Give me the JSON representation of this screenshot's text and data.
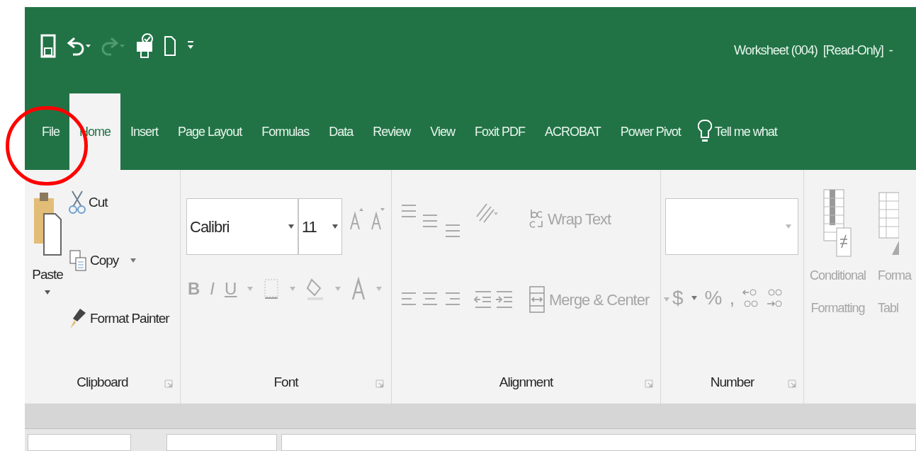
{
  "title": "Worksheet (004)  [Read-Only]  -",
  "tabs": [
    {
      "label": "File",
      "selected": false
    },
    {
      "label": "Home",
      "selected": true
    },
    {
      "label": "Insert",
      "selected": false
    },
    {
      "label": "Page Layout",
      "selected": false
    },
    {
      "label": "Formulas",
      "selected": false
    },
    {
      "label": "Data",
      "selected": false
    },
    {
      "label": "Review",
      "selected": false
    },
    {
      "label": "View",
      "selected": false
    },
    {
      "label": "Foxit PDF",
      "selected": false
    },
    {
      "label": "ACROBAT",
      "selected": false
    },
    {
      "label": "Power Pivot",
      "selected": false
    }
  ],
  "tell_me": "Tell me what",
  "clipboard": {
    "paste": {
      "label": "Paste",
      "disabled": false
    },
    "cut": {
      "label": "Cut",
      "disabled": false
    },
    "copy": {
      "label": "Copy",
      "disabled": false
    },
    "format_painter": {
      "label": "Format Painter",
      "disabled": false
    },
    "label": "Clipboard"
  },
  "font": {
    "name": "Calibri",
    "size": "11",
    "bold": {
      "label": "B",
      "disabled": true
    },
    "italic": {
      "label": "I",
      "disabled": true
    },
    "underline": {
      "label": "U",
      "disabled": true
    },
    "label": "Font"
  },
  "alignment": {
    "wrap_text": {
      "label": "Wrap Text",
      "disabled": true
    },
    "merge_center": {
      "label": "Merge & Center",
      "disabled": true
    },
    "label": "Alignment"
  },
  "number": {
    "currency": {
      "label": "$",
      "disabled": true
    },
    "percent": {
      "label": "%",
      "disabled": true
    },
    "comma": {
      "label": ",",
      "disabled": true
    },
    "label": "Number"
  },
  "styles": {
    "conditional_formatting": {
      "label": "Conditional\nFormatting",
      "disabled": true
    },
    "format_as_table": {
      "label": "Forma\nTabl",
      "disabled": true
    }
  },
  "annotations": [
    {
      "kind": "circle"
    }
  ]
}
